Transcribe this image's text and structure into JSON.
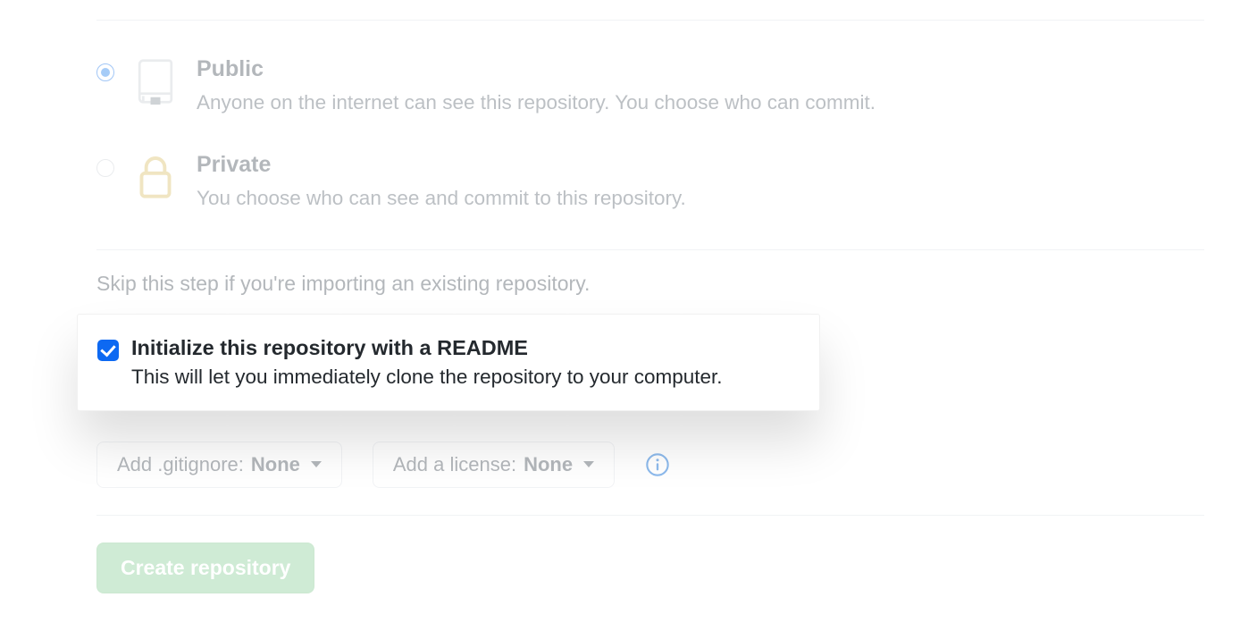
{
  "visibility": {
    "public": {
      "title": "Public",
      "desc": "Anyone on the internet can see this repository. You choose who can commit."
    },
    "private": {
      "title": "Private",
      "desc": "You choose who can see and commit to this repository."
    }
  },
  "skip_text": "Skip this step if you're importing an existing repository.",
  "readme": {
    "title": "Initialize this repository with a README",
    "desc": "This will let you immediately clone the repository to your computer."
  },
  "dropdowns": {
    "gitignore_label": "Add .gitignore: ",
    "gitignore_value": "None",
    "license_label": "Add a license: ",
    "license_value": "None"
  },
  "submit_label": "Create repository",
  "colors": {
    "accent_blue": "#0d69f2",
    "submit_green": "#94d3a2"
  }
}
